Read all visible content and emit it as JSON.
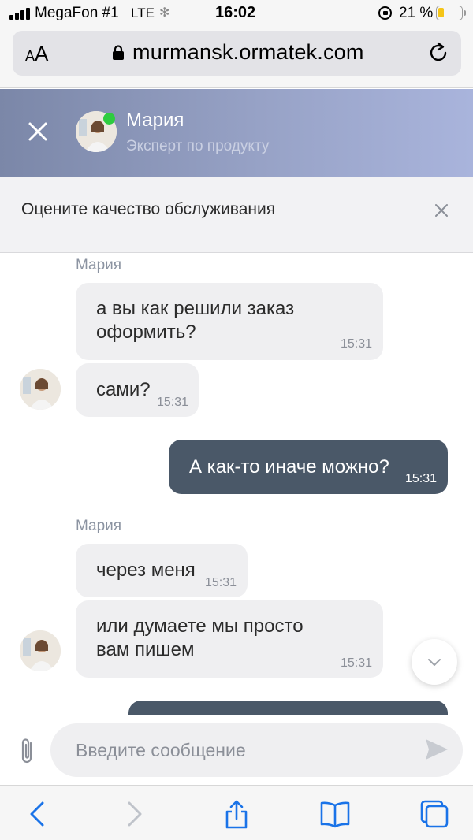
{
  "status_bar": {
    "carrier": "MegaFon #1",
    "network": "LTE",
    "time": "16:02",
    "battery_percent_label": "21 %",
    "battery_level": 0.21,
    "battery_color": "#f5c518"
  },
  "browser": {
    "text_size_label": "AA",
    "url": "murmansk.ormatek.com",
    "lock_icon": "lock-icon",
    "reload_icon": "reload-icon"
  },
  "chat_header": {
    "agent_name": "Мария",
    "agent_role": "Эксперт по продукту",
    "online": true,
    "online_color": "#2ecc40",
    "close_icon": "close-icon"
  },
  "rating_banner": {
    "text": "Оцените качество обслуживания",
    "close_icon": "close-icon"
  },
  "messages": [
    {
      "direction": "in",
      "sender": "Мария",
      "lines": [
        "а вы как решили заказ",
        "оформить?"
      ],
      "time": "15:31"
    },
    {
      "direction": "in",
      "lines": [
        "сами?"
      ],
      "time": "15:31"
    },
    {
      "direction": "out",
      "lines": [
        "А как-то иначе можно?"
      ],
      "time": "15:31"
    },
    {
      "direction": "in",
      "sender": "Мария",
      "lines": [
        "через меня"
      ],
      "time": "15:31"
    },
    {
      "direction": "in",
      "lines": [
        "или думаете мы просто",
        "вам пишем"
      ],
      "time": "15:31"
    }
  ],
  "composer": {
    "placeholder": "Введите сообщение",
    "attach_icon": "paperclip-icon",
    "send_icon": "send-icon"
  },
  "scroll_button_icon": "chevron-down-icon",
  "toolbar": {
    "back_icon": "back-arrow-icon",
    "forward_icon": "forward-arrow-icon",
    "share_icon": "share-icon",
    "bookmarks_icon": "bookmarks-icon",
    "tabs_icon": "tabs-icon"
  },
  "colors": {
    "accent": "#1a73e8",
    "header_gradient_start": "#7b87a8",
    "header_gradient_end": "#a9b4dc",
    "outgoing_bubble": "#4a5868",
    "incoming_bubble": "#efeff1"
  }
}
